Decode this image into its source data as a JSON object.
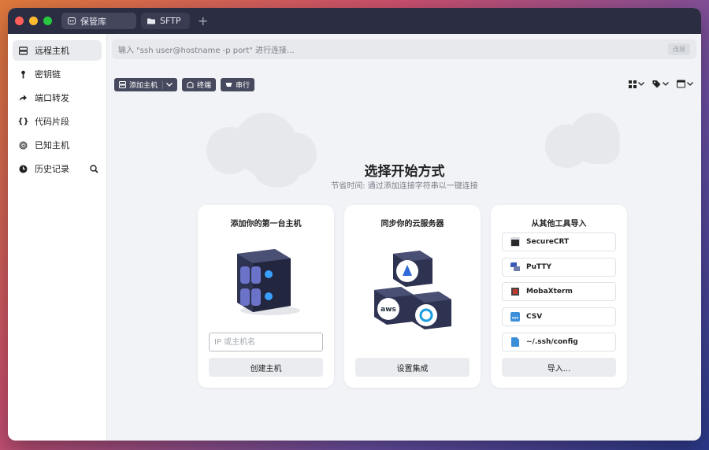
{
  "titlebar": {
    "tabs": [
      {
        "label": "保管库",
        "active": true
      },
      {
        "label": "SFTP",
        "active": false
      }
    ],
    "add_tab": "+"
  },
  "sidebar": {
    "items": [
      {
        "label": "远程主机",
        "icon": "server-icon",
        "active": true
      },
      {
        "label": "密钥链",
        "icon": "key-icon",
        "active": false
      },
      {
        "label": "端口转发",
        "icon": "forward-arrow-icon",
        "active": false
      },
      {
        "label": "代码片段",
        "icon": "braces-icon",
        "active": false
      },
      {
        "label": "已知主机",
        "icon": "fingerprint-icon",
        "active": false
      },
      {
        "label": "历史记录",
        "icon": "clock-icon",
        "active": false
      }
    ]
  },
  "connect_bar": {
    "placeholder": "输入 \"ssh user@hostname -p port\" 进行连接...",
    "button": "连接"
  },
  "toolbar": {
    "add_host": "添加主机",
    "terminal": "终端",
    "serial": "串行"
  },
  "main": {
    "heading": "选择开始方式",
    "subheading": "节省时间: 通过添加连接字符串以一键连接"
  },
  "cards": {
    "add_host": {
      "title": "添加你的第一台主机",
      "input_placeholder": "IP 或主机名",
      "button": "创建主机"
    },
    "sync_cloud": {
      "title": "同步你的云服务器",
      "aws_label": "aws",
      "button": "设置集成"
    },
    "import": {
      "title": "从其他工具导入",
      "items": [
        "SecureCRT",
        "PuTTY",
        "MobaXterm",
        "CSV",
        "~/.ssh/config"
      ],
      "csv_badge": "csv",
      "button": "导入..."
    }
  },
  "colors": {
    "titlebar": "#2b2d42",
    "accent_dark": "#474a5e",
    "window_bg": "#f1f3f6",
    "server_blue": "#3aa0ff"
  }
}
